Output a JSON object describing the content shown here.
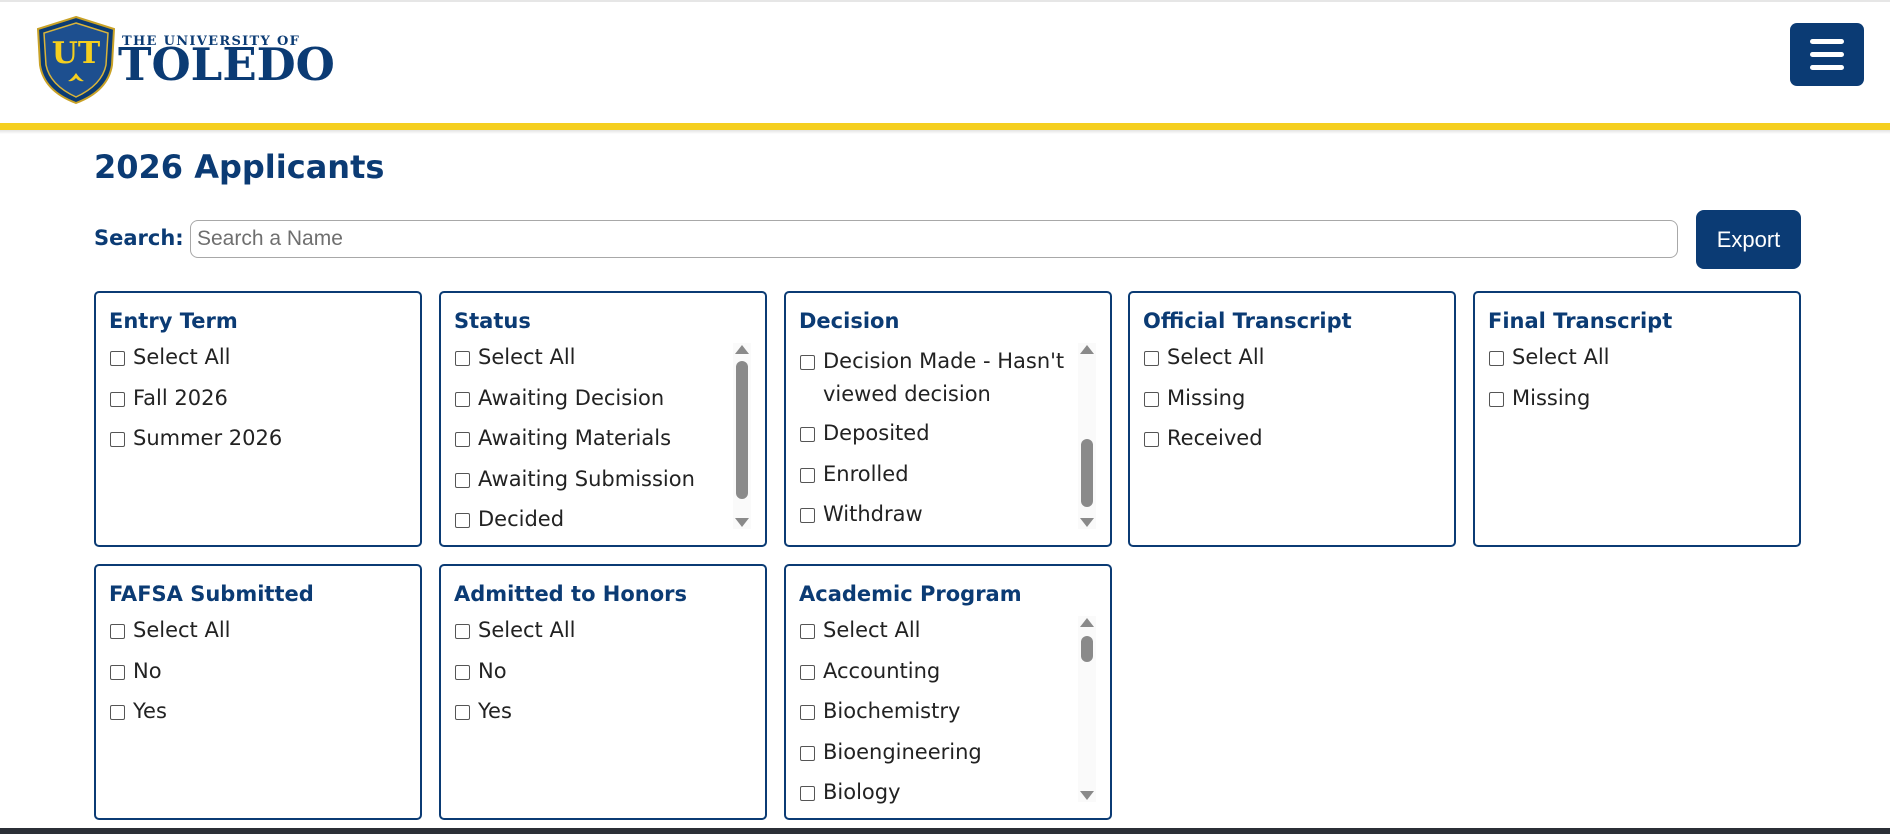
{
  "header": {
    "logo_small": "THE UNIVERSITY OF",
    "logo_big": "TOLEDO",
    "logo_mark": "UT",
    "menu_icon": "hamburger-menu-icon",
    "accent_color": "#0b3b74",
    "gold_color": "#f5cf1f"
  },
  "page": {
    "title": "2026 Applicants"
  },
  "search": {
    "label": "Search:",
    "placeholder": "Search a Name",
    "value": ""
  },
  "toolbar": {
    "export_label": "Export"
  },
  "filters": {
    "entry_term": {
      "title": "Entry Term",
      "options": [
        "Select All",
        "Fall 2026",
        "Summer 2026"
      ]
    },
    "status": {
      "title": "Status",
      "options": [
        "Select All",
        "Awaiting Decision",
        "Awaiting Materials",
        "Awaiting Submission",
        "Decided"
      ]
    },
    "decision": {
      "title": "Decision",
      "options": [
        "Decision Made - Hasn't viewed decision",
        "Deposited",
        "Enrolled",
        "Withdraw"
      ]
    },
    "official_transcript": {
      "title": "Official Transcript",
      "options": [
        "Select All",
        "Missing",
        "Received"
      ]
    },
    "final_transcript": {
      "title": "Final Transcript",
      "options": [
        "Select All",
        "Missing"
      ]
    },
    "fafsa_submitted": {
      "title": "FAFSA Submitted",
      "options": [
        "Select All",
        "No",
        "Yes"
      ]
    },
    "admitted_to_honors": {
      "title": "Admitted to Honors",
      "options": [
        "Select All",
        "No",
        "Yes"
      ]
    },
    "academic_program": {
      "title": "Academic Program",
      "options": [
        "Select All",
        "Accounting",
        "Biochemistry",
        "Bioengineering",
        "Biology"
      ]
    }
  }
}
